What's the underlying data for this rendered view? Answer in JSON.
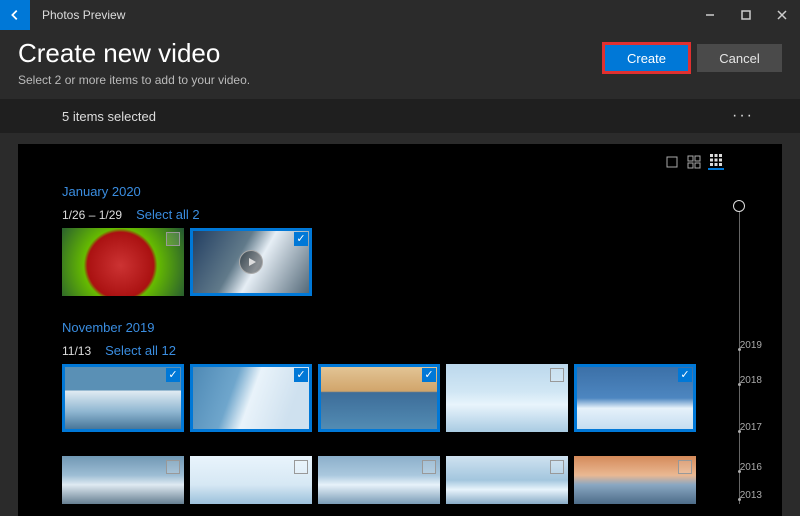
{
  "titlebar": {
    "app_title": "Photos Preview"
  },
  "header": {
    "title": "Create new video",
    "subtitle": "Select 2 or more items to add to your video.",
    "create_label": "Create",
    "cancel_label": "Cancel"
  },
  "subbar": {
    "selection_text": "5 items selected",
    "more_label": "···"
  },
  "groups": [
    {
      "month": "January 2020",
      "date_range": "1/26 – 1/29",
      "select_all_label": "Select all 2",
      "items": [
        {
          "name": "item-apple",
          "selected": false,
          "is_video": false,
          "art": "art-apple"
        },
        {
          "name": "item-stream",
          "selected": true,
          "is_video": true,
          "art": "art-stream"
        }
      ]
    },
    {
      "month": "November 2019",
      "date_range": "11/13",
      "select_all_label": "Select all 12",
      "items": [
        {
          "name": "item-ice-1",
          "selected": true,
          "is_video": false,
          "art": "art-ice1"
        },
        {
          "name": "item-ice-2",
          "selected": true,
          "is_video": false,
          "art": "art-ice2"
        },
        {
          "name": "item-ice-3",
          "selected": true,
          "is_video": false,
          "art": "art-ice3"
        },
        {
          "name": "item-ice-4",
          "selected": false,
          "is_video": false,
          "art": "art-ice4"
        },
        {
          "name": "item-ice-5",
          "selected": true,
          "is_video": false,
          "art": "art-ice5"
        }
      ],
      "items_row2": [
        {
          "name": "item-b1",
          "selected": false,
          "art": "art-b1"
        },
        {
          "name": "item-b2",
          "selected": false,
          "art": "art-b2"
        },
        {
          "name": "item-b3",
          "selected": false,
          "art": "art-b3"
        },
        {
          "name": "item-b4",
          "selected": false,
          "art": "art-b4"
        },
        {
          "name": "item-b5",
          "selected": false,
          "art": "art-b5"
        }
      ]
    }
  ],
  "timeline": {
    "years": [
      "2019",
      "2018",
      "2017",
      "2016",
      "2013"
    ]
  }
}
